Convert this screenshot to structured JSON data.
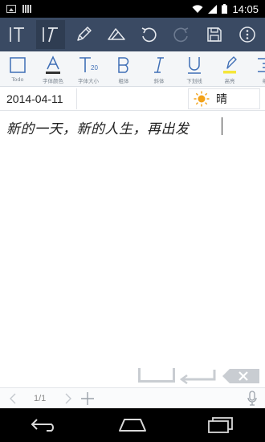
{
  "status_bar": {
    "time": "14:05"
  },
  "toolbar": {
    "buttons": [
      {
        "name": "text-mode-icon"
      },
      {
        "name": "italic-text-mode-icon"
      },
      {
        "name": "pencil-icon"
      },
      {
        "name": "eraser-icon"
      },
      {
        "name": "undo-icon"
      },
      {
        "name": "redo-icon"
      },
      {
        "name": "save-icon"
      },
      {
        "name": "more-options-icon"
      }
    ]
  },
  "format_bar": {
    "items": [
      {
        "label": "Todo"
      },
      {
        "label": "字体颜色"
      },
      {
        "label": "字体大小",
        "size_value": "20"
      },
      {
        "label": "粗体"
      },
      {
        "label": "斜体"
      },
      {
        "label": "下划线"
      },
      {
        "label": "高亮"
      },
      {
        "label": "缩"
      }
    ]
  },
  "entry": {
    "date": "2014-04-11",
    "weather": "晴",
    "weather_icon": "sun-icon",
    "content": "新的一天，新的人生，再出发"
  },
  "page_bar": {
    "page": "1/1"
  },
  "colors": {
    "toolbar_bg": "#3a4a63",
    "format_bar_bg": "#f4f6f8",
    "accent_blue": "#3f6fb6",
    "highlight_yellow": "#f5e63a",
    "sun_orange": "#f2a21a"
  }
}
